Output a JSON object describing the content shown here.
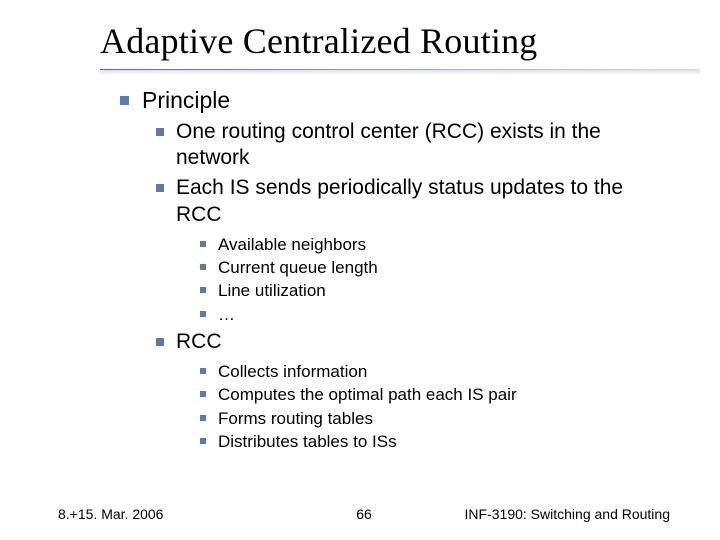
{
  "title": "Adaptive Centralized Routing",
  "bullets": {
    "l1": [
      {
        "label": "Principle"
      }
    ],
    "l2a": [
      {
        "label": "One routing control center (RCC) exists in the network"
      },
      {
        "label": "Each IS sends periodically status updates to the RCC"
      }
    ],
    "l3a": [
      {
        "label": "Available neighbors"
      },
      {
        "label": "Current queue length"
      },
      {
        "label": "Line utilization"
      },
      {
        "label": "…"
      }
    ],
    "l2b": [
      {
        "label": "RCC"
      }
    ],
    "l3b": [
      {
        "label": "Collects information"
      },
      {
        "label": "Computes the optimal path each IS pair"
      },
      {
        "label": "Forms routing tables"
      },
      {
        "label": "Distributes tables to ISs"
      }
    ]
  },
  "footer": {
    "left": "8.+15. Mar. 2006",
    "center": "66",
    "right": "INF-3190: Switching and Routing"
  }
}
